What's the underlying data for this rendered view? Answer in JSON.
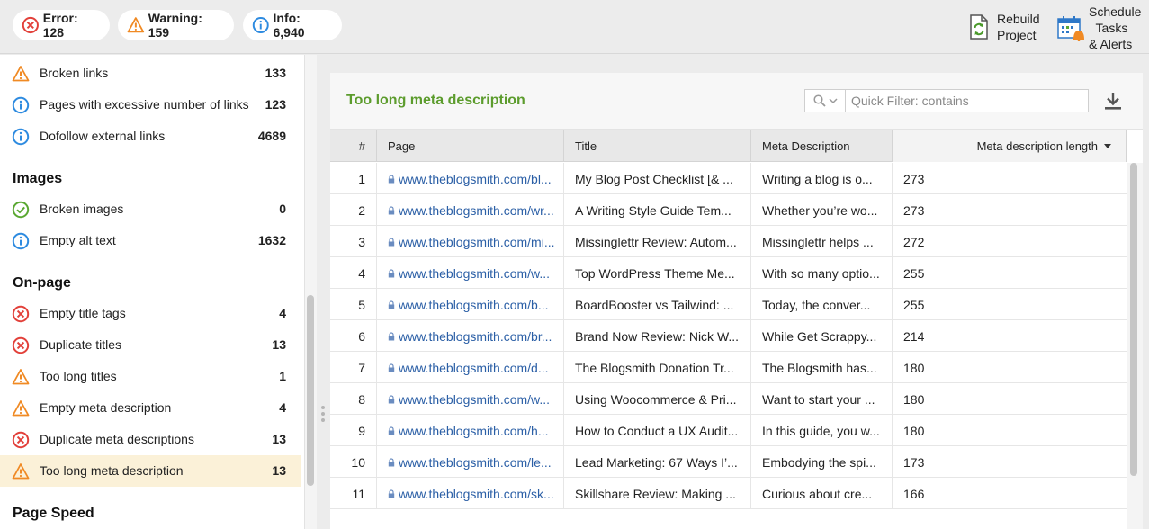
{
  "toolbar": {
    "error": "Error: 128",
    "warning": "Warning: 159",
    "info": "Info: 6,940",
    "rebuild": "Rebuild\nProject",
    "schedule": "Schedule\n  Tasks\n& Alerts"
  },
  "left": {
    "rows_top": [
      {
        "icon": "warning",
        "label": "Broken links",
        "count": "133"
      },
      {
        "icon": "info",
        "label": "Pages with excessive number of links",
        "count": "123"
      },
      {
        "icon": "info",
        "label": "Dofollow external links",
        "count": "4689"
      }
    ],
    "section_images": "Images",
    "rows_images": [
      {
        "icon": "ok",
        "label": "Broken images",
        "count": "0"
      },
      {
        "icon": "info",
        "label": "Empty alt text",
        "count": "1632"
      }
    ],
    "section_onpage": "On-page",
    "rows_onpage": [
      {
        "icon": "error",
        "label": "Empty title tags",
        "count": "4"
      },
      {
        "icon": "error",
        "label": "Duplicate titles",
        "count": "13"
      },
      {
        "icon": "warning",
        "label": "Too long titles",
        "count": "1"
      },
      {
        "icon": "warning",
        "label": "Empty meta description",
        "count": "4"
      },
      {
        "icon": "error",
        "label": "Duplicate meta descriptions",
        "count": "13"
      },
      {
        "icon": "warning",
        "label": "Too long meta description",
        "count": "13"
      }
    ],
    "section_speed": "Page Speed"
  },
  "panel": {
    "title": "Too long meta description",
    "filter_placeholder": "Quick Filter: contains",
    "columns": {
      "num": "#",
      "page": "Page",
      "title": "Title",
      "meta": "Meta Description",
      "length": "Meta description length"
    },
    "rows": [
      {
        "n": "1",
        "page": "www.theblogsmith.com/bl...",
        "title": "My Blog Post Checklist [& ...",
        "meta": "Writing a blog is o...",
        "len": "273"
      },
      {
        "n": "2",
        "page": "www.theblogsmith.com/wr...",
        "title": "A Writing Style Guide Tem...",
        "meta": "Whether you’re wo...",
        "len": "273"
      },
      {
        "n": "3",
        "page": "www.theblogsmith.com/mi...",
        "title": "Missinglettr Review: Autom...",
        "meta": "Missinglettr helps ...",
        "len": "272"
      },
      {
        "n": "4",
        "page": "www.theblogsmith.com/w...",
        "title": "Top WordPress Theme Me...",
        "meta": "With so many optio...",
        "len": "255"
      },
      {
        "n": "5",
        "page": "www.theblogsmith.com/b...",
        "title": "BoardBooster vs Tailwind: ...",
        "meta": "Today, the conver...",
        "len": "255"
      },
      {
        "n": "6",
        "page": "www.theblogsmith.com/br...",
        "title": "Brand Now Review: Nick W...",
        "meta": "While Get Scrappy...",
        "len": "214"
      },
      {
        "n": "7",
        "page": "www.theblogsmith.com/d...",
        "title": "The Blogsmith Donation Tr...",
        "meta": "The Blogsmith has...",
        "len": "180"
      },
      {
        "n": "8",
        "page": "www.theblogsmith.com/w...",
        "title": "Using Woocommerce & Pri...",
        "meta": "Want to start your ...",
        "len": "180"
      },
      {
        "n": "9",
        "page": "www.theblogsmith.com/h...",
        "title": "How to Conduct a UX Audit...",
        "meta": "In this guide, you w...",
        "len": "180"
      },
      {
        "n": "10",
        "page": "www.theblogsmith.com/le...",
        "title": "Lead Marketing: 67 Ways I’...",
        "meta": "Embodying the spi...",
        "len": "173"
      },
      {
        "n": "11",
        "page": "www.theblogsmith.com/sk...",
        "title": "Skillshare Review: Making ...",
        "meta": "Curious about cre...",
        "len": "166"
      }
    ]
  },
  "colors": {
    "error": "#e2403a",
    "warning": "#f08a24",
    "info": "#2e8be0",
    "ok": "#5aa832",
    "title_green": "#5c9c2d",
    "link_blue": "#2b5fa6"
  }
}
